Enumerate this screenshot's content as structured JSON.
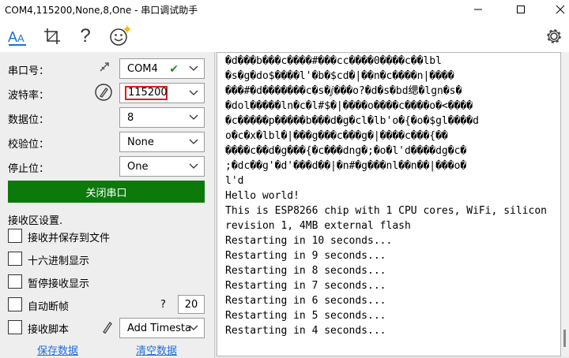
{
  "window": {
    "title": "COM4,115200,None,8,One - 串口调试助手"
  },
  "toolbar": {
    "font_icon_text": "AA",
    "help_icon_text": "?"
  },
  "settings": {
    "port_label": "串口号：",
    "port_value": "COM4",
    "baud_label": "波特率：",
    "baud_value": "115200",
    "databits_label": "数据位：",
    "databits_value": "8",
    "parity_label": "校验位：",
    "parity_value": "None",
    "stopbits_label": "停止位：",
    "stopbits_value": "One",
    "open_button": "关闭串口"
  },
  "receive": {
    "section_label": "接收区设置.",
    "save_to_file": "接收并保存到文件",
    "hex_display": "十六进制显示",
    "pause_display": "暂停接收显示",
    "auto_break": "自动断帧",
    "auto_break_help": "?",
    "auto_break_value": "20",
    "script_label": "接收脚本",
    "script_value": "Add Timesta",
    "save_data_link": "保存数据",
    "clear_data_link": "清空数据"
  },
  "terminal": {
    "lines": [
      "�d���b���c����#���cc����0����c��lbl",
      "�s�g�do$����l'�b�$cd�|��n�c����n|����",
      "���#�d�������c�s�ⅉ���o?�d�s�bd缌�lgn�s�",
      "�dol�����ln�c�l#$�|����o����c����o�<����",
      "�c�����p�����b���d�g�cl�lb'o�{�o�$gl����d",
      "o�c�x�lbl�|���g���c���g�|����c���{��",
      "����c��d�g���{�c���dng�;�o�l'd����dg�c�",
      ";�dc��g'�d'���d��|�n#�g���nl��n��|���o�",
      "l'd",
      "Hello world!",
      "This is ESP8266 chip with 1 CPU cores, WiFi, silicon",
      "revision 1, 4MB external flash",
      "Restarting in 10 seconds...",
      "Restarting in 9 seconds...",
      "Restarting in 8 seconds...",
      "Restarting in 7 seconds...",
      "Restarting in 6 seconds...",
      "Restarting in 5 seconds...",
      "Restarting in 4 seconds..."
    ]
  }
}
